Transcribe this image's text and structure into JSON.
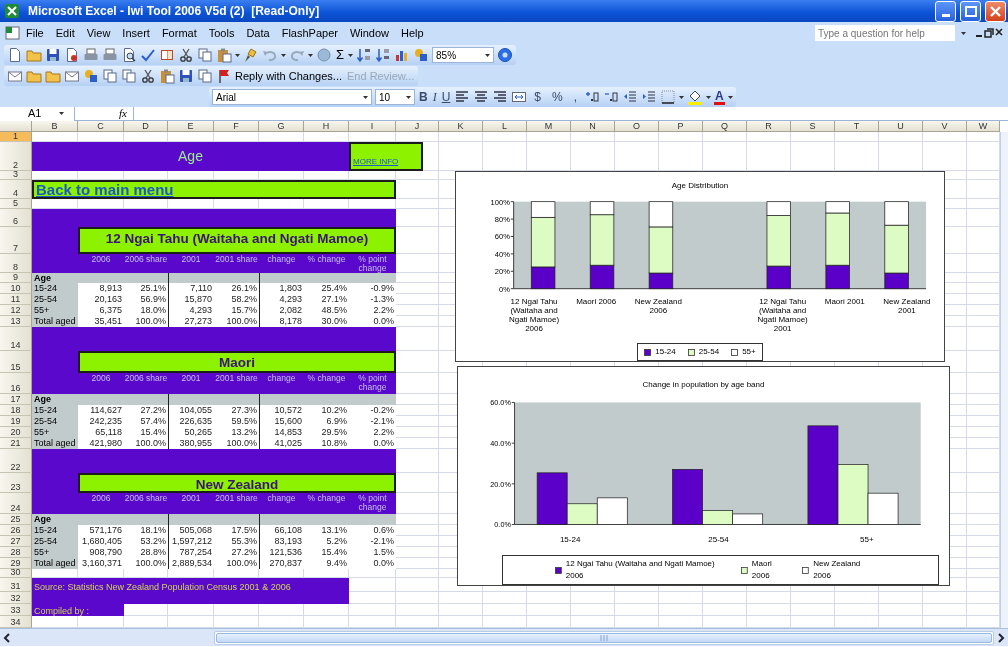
{
  "window": {
    "title": "Microsoft Excel - Iwi Tool 2006 V5d (2)  [Read-Only]"
  },
  "menu": [
    "File",
    "Edit",
    "View",
    "Insert",
    "Format",
    "Tools",
    "Data",
    "FlashPaper",
    "Window",
    "Help"
  ],
  "help_box": {
    "placeholder": "Type a question for help"
  },
  "standard_toolbar": {
    "autosum": "Σ",
    "zoom": "85%"
  },
  "reviewing_toolbar": {
    "buttons": [
      {
        "label": "Reply with Changes...",
        "kind": "reply",
        "disabled": false
      },
      {
        "label": "End Review...",
        "kind": "end",
        "disabled": true
      }
    ]
  },
  "formatting_toolbar": {
    "font": "Arial",
    "size": "10",
    "style_buttons": [
      {
        "label": "B",
        "kind": "bold"
      },
      {
        "label": "I",
        "kind": "italic"
      },
      {
        "label": "U",
        "kind": "underline"
      }
    ],
    "number_buttons": [
      "$",
      "%",
      ","
    ],
    "font_color": "A"
  },
  "formula_bar": {
    "name_box": "A1",
    "fx": "fx"
  },
  "column_headers": [
    "B",
    "C",
    "D",
    "E",
    "F",
    "G",
    "H",
    "I",
    "J",
    "K",
    "L",
    "M",
    "N",
    "O",
    "P",
    "Q",
    "R",
    "S",
    "T",
    "U",
    "V",
    "W"
  ],
  "row_headers": [
    {
      "label": "1",
      "selected": true
    },
    {
      "label": "2",
      "selected": false
    },
    {
      "label": "3",
      "selected": false
    },
    {
      "label": "4",
      "selected": false
    },
    {
      "label": "5",
      "selected": false
    },
    {
      "label": "6",
      "selected": false
    },
    {
      "label": "7",
      "selected": false
    },
    {
      "label": "8",
      "selected": false
    },
    {
      "label": "9",
      "selected": false
    },
    {
      "label": "10",
      "selected": false
    },
    {
      "label": "11",
      "selected": false
    },
    {
      "label": "12",
      "selected": false
    },
    {
      "label": "13",
      "selected": false
    },
    {
      "label": "14",
      "selected": false
    },
    {
      "label": "15",
      "selected": false
    },
    {
      "label": "16",
      "selected": false
    },
    {
      "label": "17",
      "selected": false
    },
    {
      "label": "18",
      "selected": false
    },
    {
      "label": "19",
      "selected": false
    },
    {
      "label": "20",
      "selected": false
    },
    {
      "label": "21",
      "selected": false
    },
    {
      "label": "22",
      "selected": false
    },
    {
      "label": "23",
      "selected": false
    },
    {
      "label": "24",
      "selected": false
    },
    {
      "label": "25",
      "selected": false
    },
    {
      "label": "26",
      "selected": false
    },
    {
      "label": "27",
      "selected": false
    },
    {
      "label": "28",
      "selected": false
    },
    {
      "label": "29",
      "selected": false
    },
    {
      "label": "30",
      "selected": false
    },
    {
      "label": "31",
      "selected": false
    },
    {
      "label": "32",
      "selected": false
    },
    {
      "label": "33",
      "selected": false
    },
    {
      "label": "34",
      "selected": false
    }
  ],
  "sheet": {
    "title": "Age",
    "more_info": "MORE INFO",
    "back_link": "Back to main menu",
    "sections": [
      {
        "title": "12 Ngai Tahu (Waitaha and Ngati Mamoe)",
        "headers": [
          "2006",
          "2006 share",
          "2001",
          "2001 share",
          "change",
          "% change",
          "% point change"
        ],
        "group_label": "Age",
        "rows": [
          {
            "label": "15-24",
            "values": [
              "8,913",
              "25.1%",
              "7,110",
              "26.1%",
              "1,803",
              "25.4%",
              "-0.9%"
            ]
          },
          {
            "label": "25-54",
            "values": [
              "20,163",
              "56.9%",
              "15,870",
              "58.2%",
              "4,293",
              "27.1%",
              "-1.3%"
            ]
          },
          {
            "label": "55+",
            "values": [
              "6,375",
              "18.0%",
              "4,293",
              "15.7%",
              "2,082",
              "48.5%",
              "2.2%"
            ]
          },
          {
            "label": "Total aged",
            "values": [
              "35,451",
              "100.0%",
              "27,273",
              "100.0%",
              "8,178",
              "30.0%",
              "0.0%"
            ]
          }
        ]
      },
      {
        "title": "Maori",
        "headers": [
          "2006",
          "2006 share",
          "2001",
          "2001 share",
          "change",
          "% change",
          "% point change"
        ],
        "group_label": "Age",
        "rows": [
          {
            "label": "15-24",
            "values": [
              "114,627",
              "27.2%",
              "104,055",
              "27.3%",
              "10,572",
              "10.2%",
              "-0.2%"
            ]
          },
          {
            "label": "25-54",
            "values": [
              "242,235",
              "57.4%",
              "226,635",
              "59.5%",
              "15,600",
              "6.9%",
              "-2.1%"
            ]
          },
          {
            "label": "55+",
            "values": [
              "65,118",
              "15.4%",
              "50,265",
              "13.2%",
              "14,853",
              "29.5%",
              "2.2%"
            ]
          },
          {
            "label": "Total aged",
            "values": [
              "421,980",
              "100.0%",
              "380,955",
              "100.0%",
              "41,025",
              "10.8%",
              "0.0%"
            ]
          }
        ]
      },
      {
        "title": "New Zealand",
        "headers": [
          "2006",
          "2006 share",
          "2001",
          "2001 share",
          "change",
          "% change",
          "% point change"
        ],
        "group_label": "Age",
        "rows": [
          {
            "label": "15-24",
            "values": [
              "571,176",
              "18.1%",
              "505,068",
              "17.5%",
              "66,108",
              "13.1%",
              "0.6%"
            ]
          },
          {
            "label": "25-54",
            "values": [
              "1,680,405",
              "53.2%",
              "1,597,212",
              "55.3%",
              "83,193",
              "5.2%",
              "-2.1%"
            ]
          },
          {
            "label": "55+",
            "values": [
              "908,790",
              "28.8%",
              "787,254",
              "27.2%",
              "121,536",
              "15.4%",
              "1.5%"
            ]
          },
          {
            "label": "Total aged",
            "values": [
              "3,160,371",
              "100.0%",
              "2,889,534",
              "100.0%",
              "270,837",
              "9.4%",
              "0.0%"
            ]
          }
        ]
      }
    ],
    "source": "Source: Statistics New Zealand Population Census 2001 & 2006",
    "compiled_by": "Compiled by :"
  },
  "charts": [
    {
      "chart_data": {
        "type": "bar",
        "title": "Age Distribution",
        "stacked": true,
        "legend": "bottom",
        "categories": [
          "12 Ngai Tahu (Waitaha and Ngati Mamoe) 2006",
          "Maori 2006",
          "New Zealand 2006",
          null,
          "12 Ngai Tahu (Waitaha and Ngati Mamoe) 2001",
          "Maori 2001",
          "New Zealand 2001"
        ],
        "series": [
          {
            "name": "15-24",
            "color": "#5a00c8",
            "values": [
              25,
              27,
              18,
              null,
              26,
              27,
              18
            ]
          },
          {
            "name": "25-54",
            "color": "#dcfcc4",
            "values": [
              57,
              58,
              53,
              null,
              58,
              60,
              55
            ]
          },
          {
            "name": "55+",
            "color": "#ffffff",
            "values": [
              18,
              15,
              29,
              null,
              16,
              13,
              27
            ]
          }
        ],
        "ylim": [
          0,
          100
        ],
        "yticks": [
          {
            "value": 0,
            "label": "0%"
          },
          {
            "value": 20,
            "label": "20%"
          },
          {
            "value": 40,
            "label": "40%"
          },
          {
            "value": 60,
            "label": "60%"
          },
          {
            "value": 80,
            "label": "80%"
          },
          {
            "value": 100,
            "label": "100%"
          }
        ]
      }
    },
    {
      "chart_data": {
        "type": "bar",
        "title": "Change in population by age band",
        "legend": "bottom",
        "categories": [
          "15-24",
          "25-54",
          "55+"
        ],
        "series": [
          {
            "name": "12 Ngai Tahu (Waitaha and Ngati Mamoe) 2006",
            "color": "#5a00c8",
            "values": [
              25.4,
              27.1,
              48.5
            ]
          },
          {
            "name": "Maori 2006",
            "color": "#dcfcc4",
            "values": [
              10.2,
              6.9,
              29.5
            ]
          },
          {
            "name": "New Zealand 2006",
            "color": "#ffffff",
            "values": [
              13.1,
              5.2,
              15.4
            ]
          }
        ],
        "ylim": [
          0,
          60
        ],
        "yticks": [
          {
            "value": 0,
            "label": "0.0%"
          },
          {
            "value": 20,
            "label": "20.0%"
          },
          {
            "value": 40,
            "label": "40.0%"
          },
          {
            "value": 60,
            "label": "60.0%"
          }
        ]
      }
    }
  ]
}
